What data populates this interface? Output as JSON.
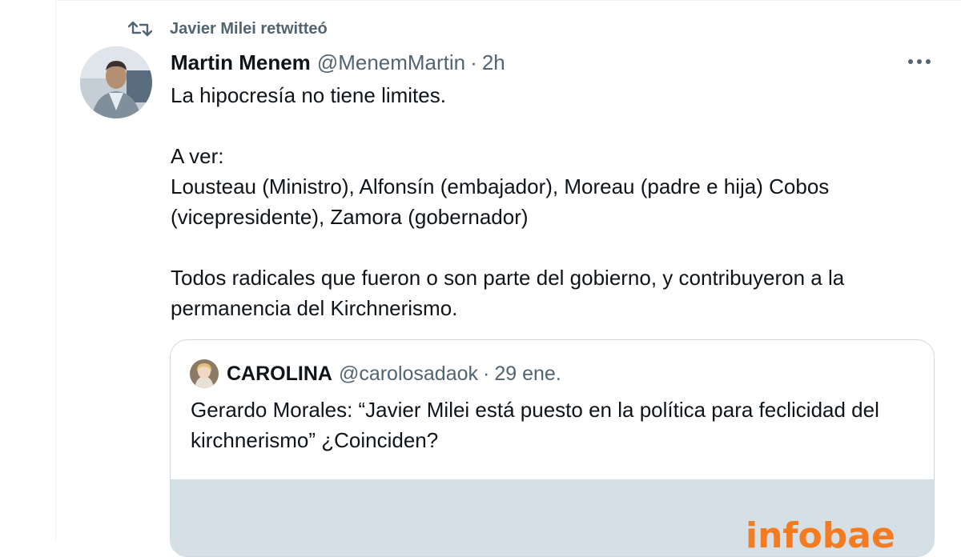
{
  "retweet": {
    "label": "Javier Milei retwitteó",
    "icon": "retweet-icon"
  },
  "tweet": {
    "author_name": "Martin Menem",
    "author_handle": "@MenemMartin",
    "separator": "·",
    "time": "2h",
    "paragraphs": [
      "La hipocresía no tiene limites.",
      "A ver:",
      "Lousteau (Ministro), Alfonsín (embajador), Moreau (padre e hija) Cobos (vicepresidente), Zamora (gobernador)",
      "Todos radicales que fueron o son parte del gobierno, y contribuyeron a la permanencia del Kirchnerismo."
    ]
  },
  "quote": {
    "author_name": "CAROLINA",
    "author_handle": "@carolosadaok",
    "separator": "·",
    "time": "29 ene.",
    "text": "Gerardo Morales: “Javier Milei está puesto en la política para feclicidad del kirchnerismo” ¿Coinciden?",
    "media_logo": "infobae"
  },
  "colors": {
    "secondary_text": "#536471",
    "border": "#cfd9de",
    "infobae_orange": "#f47b20"
  }
}
